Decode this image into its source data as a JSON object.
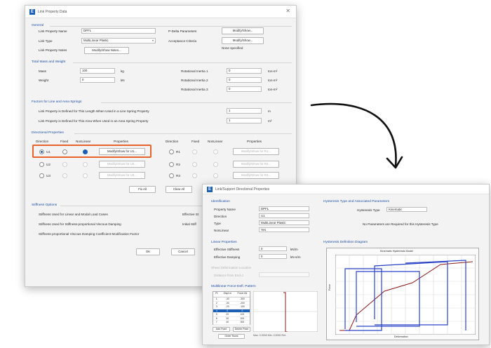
{
  "dialog1": {
    "title": "Link Property Data",
    "close": "✕",
    "general": {
      "header": "General",
      "link_property_name_label": "Link Property Name",
      "link_property_name_value": "DPFL",
      "link_type_label": "Link Type",
      "link_type_value": "MultiLinear Plastic",
      "link_property_notes_label": "Link Property Notes",
      "modify_notes_btn": "Modify/Show Notes...",
      "pdelta_label": "P-Delta Parameters",
      "pdelta_btn": "Modify/Show...",
      "acceptance_label": "Acceptance Criteria",
      "acceptance_btn": "Modify/Show...",
      "acceptance_status": "None specified"
    },
    "mass_weight": {
      "header": "Total Mass and Weight",
      "mass_label": "Mass",
      "mass_value": "100",
      "mass_unit": "kg",
      "weight_label": "Weight",
      "weight_value": "0",
      "weight_unit": "kN",
      "ri1_label": "Rotational Inertia 1",
      "ri1_value": "0",
      "ri1_unit": "ton-m²",
      "ri2_label": "Rotational Inertia 2",
      "ri2_value": "0",
      "ri2_unit": "ton-m²",
      "ri3_label": "Rotational Inertia 3",
      "ri3_value": "0",
      "ri3_unit": "ton-m²"
    },
    "factors": {
      "header": "Factors for Line and Area Springs",
      "line_label": "Link Property is Defined for This Length When Used in a Line Spring Property",
      "line_value": "1",
      "line_unit": "m",
      "area_label": "Link Property is Defined for This Area When Used in an Area Spring Property",
      "area_value": "1",
      "area_unit": "m²"
    },
    "dof": {
      "header": "Directional Properties",
      "col_direction": "Direction",
      "col_fixed": "Fixed",
      "col_nonlinear": "NonLinear",
      "col_properties": "Properties",
      "rows_left": [
        {
          "dir": "U1",
          "btn": "Modify/Show for U1..."
        },
        {
          "dir": "U2",
          "btn": "Modify/Show for U2..."
        },
        {
          "dir": "U3",
          "btn": "Modify/Show for U3..."
        }
      ],
      "rows_right": [
        {
          "dir": "R1",
          "btn": "Modify/Show for R1..."
        },
        {
          "dir": "R2",
          "btn": "Modify/Show for R2..."
        },
        {
          "dir": "R3",
          "btn": "Modify/Show for R3..."
        }
      ],
      "fix_all_btn": "Fix All",
      "clear_all_btn": "Clear All"
    },
    "stiffness": {
      "header": "Stiffness Options",
      "opt1": "Stiffness Used for Linear and Modal Load Cases",
      "opt1_value": "Effective St",
      "opt2": "Stiffness Used for Stiffness-proportional Viscous Damping",
      "opt2_value": "Initial Stiff",
      "opt3": "Stiffness-proportional Viscous Damping Coefficient Modification Factor"
    },
    "ok_btn": "OK",
    "cancel_btn": "Cancel"
  },
  "dialog2": {
    "title": "Link/Support Directional Properties",
    "identification": {
      "header": "Identification",
      "property_name_label": "Property Name",
      "property_name_value": "DPFL",
      "direction_label": "Direction",
      "direction_value": "U1",
      "type_label": "Type",
      "type_value": "MultiLinear Plastic",
      "nonlinear_label": "NonLinear",
      "nonlinear_value": "Yes"
    },
    "linear": {
      "header": "Linear Properties",
      "eff_stiff_label": "Effective Stiffness",
      "eff_stiff_value": "0",
      "eff_stiff_unit": "kN/m",
      "eff_damp_label": "Effective Damping",
      "eff_damp_value": "0",
      "eff_damp_unit": "kN-s/m"
    },
    "shear_deform": {
      "header": "Shear Deformation Location",
      "distance_label": "Distance from End-J"
    },
    "force_def": {
      "header": "Multilinear Force-Defl. Pattern",
      "col_pt": "Pt",
      "col_disp": "Displ m",
      "col_force": "Force kN",
      "rows": [
        {
          "pt": "1",
          "d": "-40",
          "f": "-300"
        },
        {
          "pt": "2",
          "d": "-30",
          "f": "-200"
        },
        {
          "pt": "3",
          "d": "-20",
          "f": "-100"
        },
        {
          "pt": "4",
          "d": "0",
          "f": "0"
        },
        {
          "pt": "5",
          "d": "20",
          "f": "100"
        },
        {
          "pt": "6",
          "d": "30",
          "f": "200"
        },
        {
          "pt": "7",
          "d": "40",
          "f": "300"
        }
      ],
      "add_btn": "Add Point",
      "delete_btn": "Delete Point",
      "order_btn": "Order Rows"
    },
    "hysteresis": {
      "header": "Hysteresis Type and Associated Parameters",
      "type_label": "Hysteresis Type",
      "type_value": "Kinematic",
      "note": "No Parameters are Required for this Hysteresis Type"
    },
    "diagram": {
      "header": "Hysteresis Definition Diagram",
      "plot_title": "Kinematic Hysteresis Model",
      "x_label": "Deformation",
      "y_label": "Force",
      "status": "Max. 0.0000  Min. 0.0000  Ret."
    }
  },
  "colors": {
    "accent": "#1b5fb4",
    "highlight": "#e8632b",
    "hysteresis_line": "#2a44c8",
    "backbone": "#8a1a1a"
  }
}
